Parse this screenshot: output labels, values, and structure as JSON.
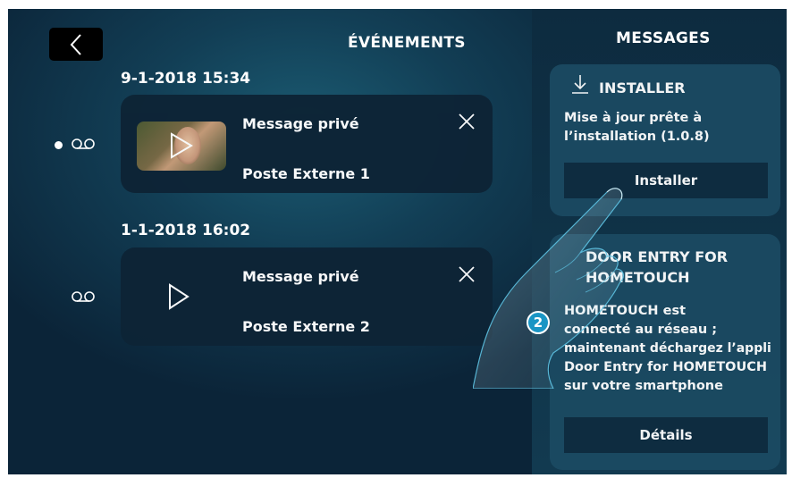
{
  "events": {
    "title": "ÉVÉNEMENTS",
    "items": [
      {
        "date": "9-1-2018  15:34",
        "title": "Message privé",
        "source": "Poste Externe 1",
        "unread": true,
        "has_thumbnail": true
      },
      {
        "date": "1-1-2018  16:02",
        "title": "Message privé",
        "source": "Poste Externe 2",
        "unread": false,
        "has_thumbnail": false
      }
    ]
  },
  "messages": {
    "title": "MESSAGES",
    "installer": {
      "header": "INSTALLER",
      "text_line1": "Mise à jour prête à",
      "text_line2": "l’installation (1.0.8)",
      "button": "Installer"
    },
    "door_entry": {
      "header_line1": "DOOR ENTRY FOR",
      "header_line2": "HOMETOUCH",
      "text_lines": [
        "HOMETOUCH est",
        "connecté au réseau ;",
        "maintenant déchargez l’appli",
        "Door Entry for HOMETOUCH",
        "sur votre smartphone"
      ],
      "button": "Détails"
    }
  },
  "gesture": {
    "step_number": "2"
  },
  "colors": {
    "accent_badge": "#1a95c4",
    "panel_bg": "#0f3247",
    "card_bg": "#0d2436"
  }
}
